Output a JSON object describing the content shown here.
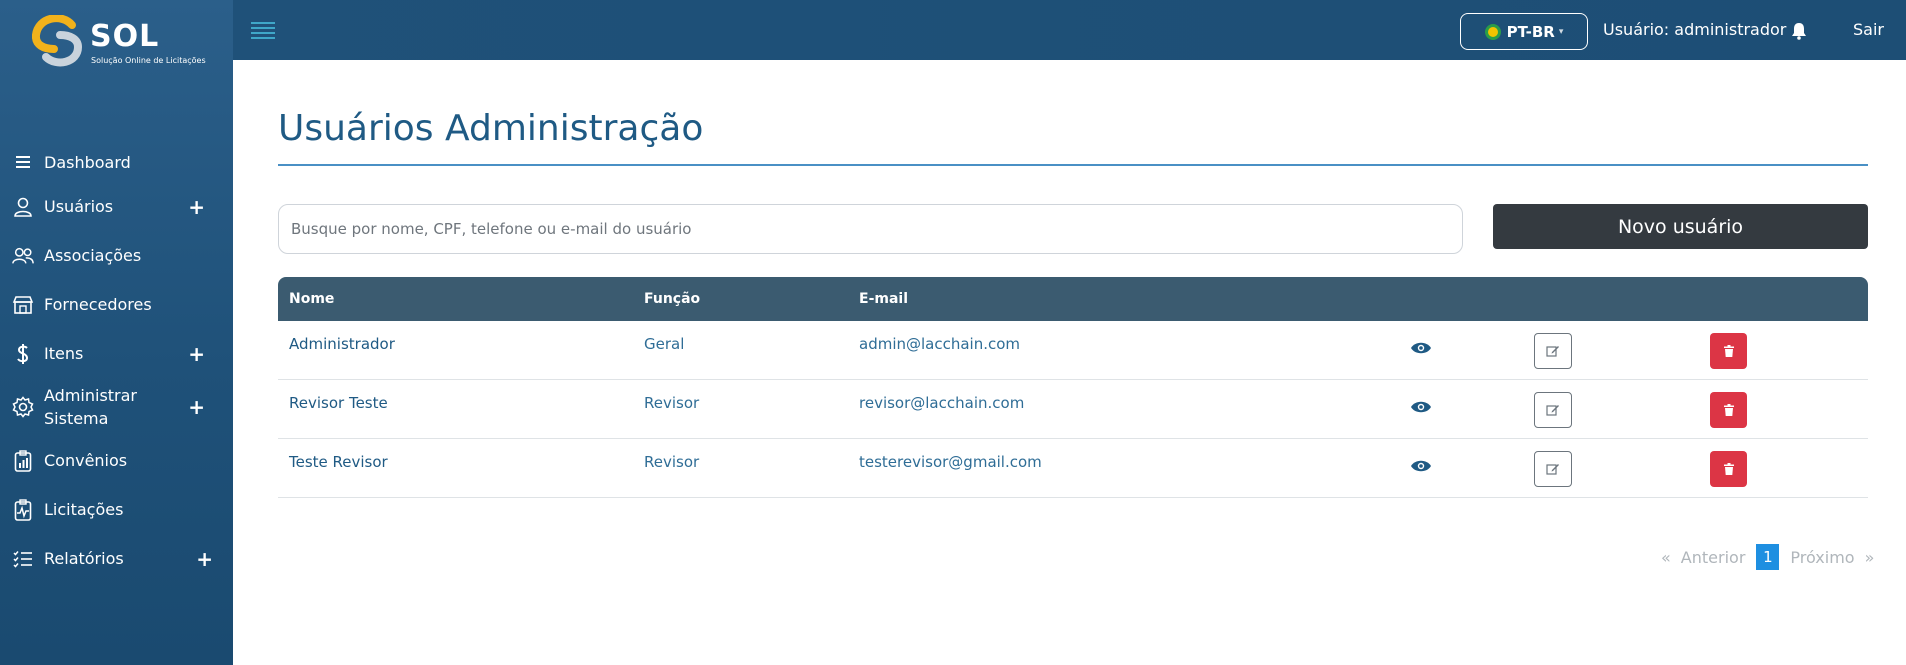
{
  "app": {
    "logo_text": "SOL",
    "logo_subtitle": "Solução Online de Licitações"
  },
  "sidebar": {
    "items": [
      {
        "label": "Dashboard",
        "icon": "menu-lines-icon",
        "expandable": false
      },
      {
        "label": "Usuários",
        "icon": "user-icon",
        "expandable": true
      },
      {
        "label": "Associações",
        "icon": "users-group-icon",
        "expandable": false
      },
      {
        "label": "Fornecedores",
        "icon": "store-icon",
        "expandable": false
      },
      {
        "label": "Itens",
        "icon": "dollar-icon",
        "expandable": true
      },
      {
        "label": "Administrar Sistema",
        "icon": "gear-icon",
        "expandable": true
      },
      {
        "label": "Convênios",
        "icon": "clipboard-chart-icon",
        "expandable": false
      },
      {
        "label": "Licitações",
        "icon": "clipboard-pulse-icon",
        "expandable": false
      },
      {
        "label": "Relatórios",
        "icon": "checklist-icon",
        "expandable": true
      }
    ],
    "expand_symbol": "+"
  },
  "topbar": {
    "language": "PT-BR",
    "user_label": "Usuário: administrador",
    "logout_label": "Sair"
  },
  "main": {
    "title": "Usuários Administração",
    "search_placeholder": "Busque por nome, CPF, telefone ou e-mail do usuário",
    "new_user_label": "Novo usuário",
    "table": {
      "headers": [
        "Nome",
        "Função",
        "E-mail"
      ],
      "rows": [
        {
          "name": "Administrador",
          "role": "Geral",
          "email": "admin@lacchain.com"
        },
        {
          "name": "Revisor Teste",
          "role": "Revisor",
          "email": "revisor@lacchain.com"
        },
        {
          "name": "Teste Revisor",
          "role": "Revisor",
          "email": "testerevisor@gmail.com"
        }
      ]
    },
    "pagination": {
      "prev_symbol": "«",
      "prev_label": "Anterior",
      "current_page": "1",
      "next_label": "Próximo",
      "next_symbol": "»"
    }
  },
  "colors": {
    "sidebar": "#1f5179",
    "accent": "#1e8fe1",
    "delete": "#dc3545",
    "table_header": "#3b5b70",
    "primary_button": "#343a40"
  }
}
